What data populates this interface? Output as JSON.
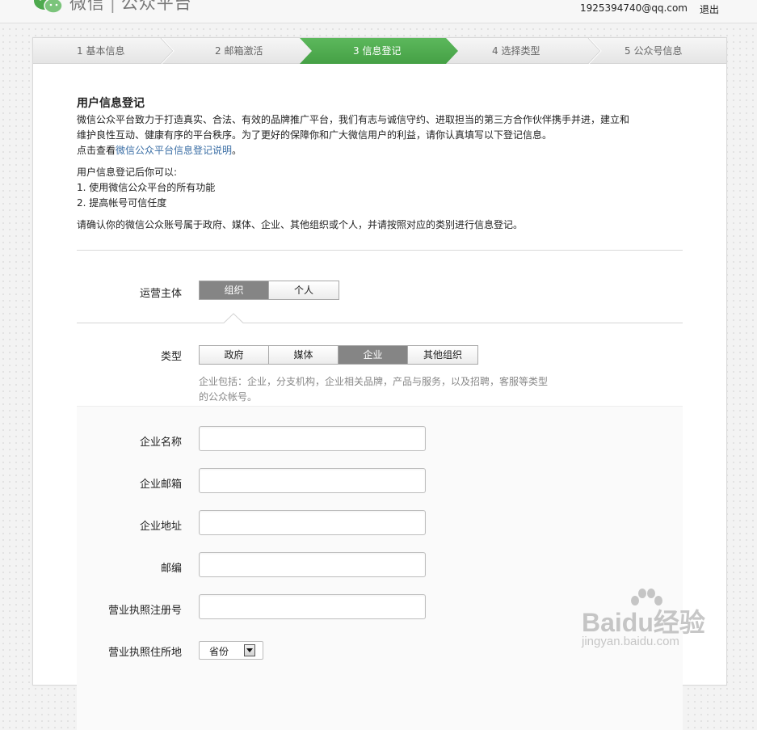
{
  "header": {
    "brand_text": "微信",
    "brand_sep": "|",
    "brand_sub": "公众平台",
    "account": "1925394740@qq.com",
    "logout": "退出"
  },
  "steps": [
    {
      "label": "1 基本信息",
      "active": false
    },
    {
      "label": "2 邮箱激活",
      "active": false
    },
    {
      "label": "3 信息登记",
      "active": true
    },
    {
      "label": "4 选择类型",
      "active": false
    },
    {
      "label": "5 公众号信息",
      "active": false
    }
  ],
  "colors": {
    "active_step": "#4eaa4e",
    "selected_segment": "#858585",
    "link": "#3a6ea5"
  },
  "intro": {
    "title": "用户信息登记",
    "para1_line1": "微信公众平台致力于打造真实、合法、有效的品牌推广平台，我们有志与诚信守约、进取担当的第三方合作伙伴携手并进，建立和",
    "para1_line2": "维护良性互动、健康有序的平台秩序。为了更好的保障你和广大微信用户的利益，请你认真填写以下登记信息。",
    "link_prefix": "点击查看",
    "link_text": "微信公众平台信息登记说明",
    "link_suffix": "。",
    "after_title": "用户信息登记后你可以:",
    "benefit1": "1. 使用微信公众平台的所有功能",
    "benefit2": "2. 提高帐号可信任度",
    "confirm": "请确认你的微信公众账号属于政府、媒体、企业、其他组织或个人，并请按照对应的类别进行信息登记。"
  },
  "operator": {
    "label": "运营主体",
    "options": [
      "组织",
      "个人"
    ],
    "selected": "组织"
  },
  "org_type": {
    "label": "类型",
    "options": [
      "政府",
      "媒体",
      "企业",
      "其他组织"
    ],
    "selected": "企业",
    "hint_line1": "企业包括：企业，分支机构，企业相关品牌，产品与服务，以及招聘，客服等类型",
    "hint_line2": "的公众帐号。"
  },
  "form": {
    "company_name_label": "企业名称",
    "company_email_label": "企业邮箱",
    "company_address_label": "企业地址",
    "postcode_label": "邮编",
    "license_number_label": "营业执照注册号",
    "license_location_label": "营业执照住所地",
    "company_name_value": "",
    "company_email_value": "",
    "company_address_value": "",
    "postcode_value": "",
    "license_number_value": "",
    "province_value": "省份"
  },
  "watermark": {
    "text": "Baidu经验",
    "url": "jingyan.baidu.com"
  }
}
